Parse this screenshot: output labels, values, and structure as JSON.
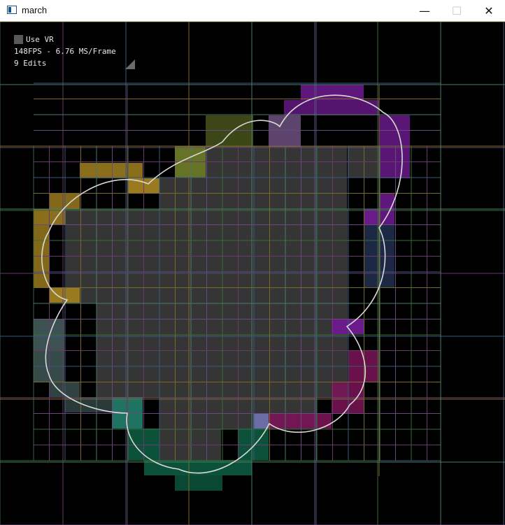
{
  "window": {
    "title": "march",
    "controls": {
      "minimize": "—",
      "maximize": "☐",
      "close": "✕"
    }
  },
  "overlay": {
    "use_vr_label": "Use VR",
    "use_vr_checked": false,
    "fps_text": "148FPS - 6.76 MS/Frame",
    "edits_text": "9 Edits"
  },
  "colors": {
    "background": "#000000",
    "solid_cell": "#353535",
    "outline": "#d8d8d8",
    "gold": "#9a7a1e",
    "purple": "#6a1a8a",
    "magenta": "#7a1458",
    "teal": "#22806e",
    "green": "#0d5a40",
    "olive": "#6f7f2a",
    "navy": "#1c2844",
    "slate": "#3c5252"
  }
}
